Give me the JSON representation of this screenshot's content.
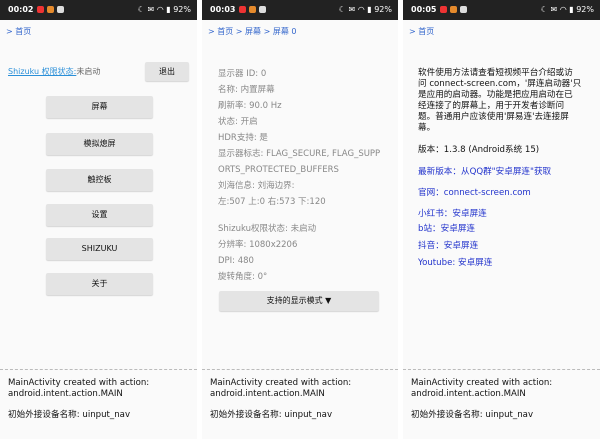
{
  "screens": [
    {
      "status": {
        "time": "00:02",
        "battery": "92%"
      },
      "breadcrumb": [
        "首页"
      ],
      "shizuku_link": "Shizuku 权限状态:",
      "shizuku_value": "未启动",
      "exit_label": "退出",
      "menu": [
        "屏幕",
        "模拟熄屏",
        "触控板",
        "设置",
        "SHIZUKU",
        "关于"
      ],
      "log_line1": "MainActivity created with action:",
      "log_line2": "android.intent.action.MAIN",
      "log_line3": "初始外接设备名称: uinput_nav"
    },
    {
      "status": {
        "time": "00:03",
        "battery": "92%"
      },
      "breadcrumb": [
        "首页",
        "屏幕",
        "屏幕 0"
      ],
      "info": [
        "显示器 ID: 0",
        "名称: 内置屏幕",
        "刷新率: 90.0 Hz",
        "状态: 开启",
        "HDR支持: 是",
        "显示器标志: FLAG_SECURE, FLAG_SUPP",
        "ORTS_PROTECTED_BUFFERS",
        "刘海信息: 刘海边界:",
        "左:507 上:0 右:573 下:120"
      ],
      "info2": [
        "Shizuku权限状态: 未启动",
        "分辨率: 1080x2206",
        "DPI: 480",
        "旋转角度: 0°"
      ],
      "modes_button": "支持的显示模式 ▼",
      "log_line1": "MainActivity created with action:",
      "log_line2": "android.intent.action.MAIN",
      "log_line3": "初始外接设备名称: uinput_nav"
    },
    {
      "status": {
        "time": "00:05",
        "battery": "92%"
      },
      "breadcrumb": [
        "首页"
      ],
      "about_lines": [
        "软件使用方法请查看短视频平台介绍或访",
        "问 connect-screen.com，'屏连启动器'只",
        "是应用的启动器。功能是把应用启动在已",
        "经连接了的屏幕上，用于开发者诊断问",
        "题。普通用户应该使用'屏易连'去连接屏",
        "幕。"
      ],
      "version": "版本：1.3.8 (Android系统 15)",
      "latest": "最新版本：从QQ群\"安卓屏连\"获取",
      "website": "官网：connect-screen.com",
      "xiaohongshu": "小红书：安卓屏连",
      "bilibili": "b站：安卓屏连",
      "douyin": "抖音：安卓屏连",
      "youtube": "Youtube: 安卓屏连",
      "log_line1": "MainActivity created with action:",
      "log_line2": "android.intent.action.MAIN",
      "log_line3": "初始外接设备名称: uinput_nav"
    }
  ],
  "colors": {
    "link": "#3366cc",
    "deep_link": "#2233cc",
    "status_bar": "#222222",
    "button": "#e4e4e4"
  }
}
